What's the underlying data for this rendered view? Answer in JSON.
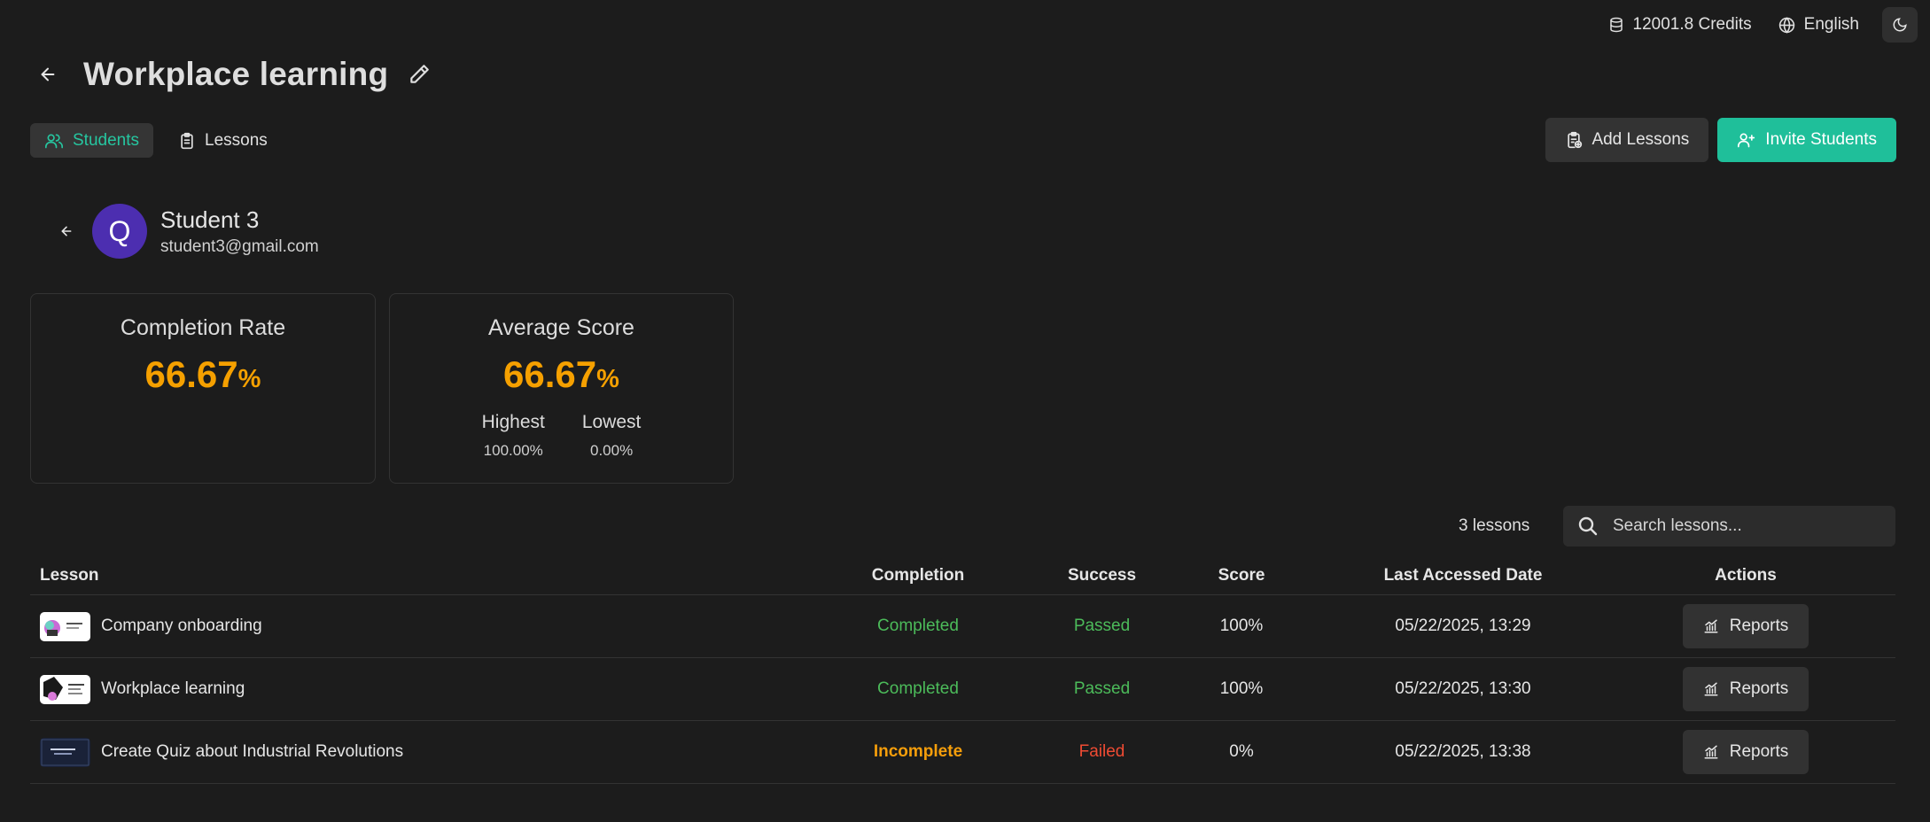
{
  "topbar": {
    "credits": "12001.8 Credits",
    "language": "English",
    "credits_icon": "database-icon",
    "language_icon": "globe-icon",
    "theme_icon": "moon-icon"
  },
  "header": {
    "title": "Workplace learning"
  },
  "tabs": [
    {
      "label": "Students",
      "active": true
    },
    {
      "label": "Lessons",
      "active": false
    }
  ],
  "actions": {
    "add_lessons": "Add Lessons",
    "invite_students": "Invite Students"
  },
  "student": {
    "initial": "Q",
    "name": "Student 3",
    "email": "student3@gmail.com"
  },
  "stats": {
    "completion": {
      "title": "Completion Rate",
      "value": "66.67",
      "unit": "%"
    },
    "average": {
      "title": "Average Score",
      "value": "66.67",
      "unit": "%",
      "highest_label": "Highest",
      "highest_value": "100.00%",
      "lowest_label": "Lowest",
      "lowest_value": "0.00%"
    }
  },
  "table": {
    "count": "3 lessons",
    "search_placeholder": "Search lessons...",
    "headers": {
      "lesson": "Lesson",
      "completion": "Completion",
      "success": "Success",
      "score": "Score",
      "date": "Last Accessed Date",
      "actions": "Actions"
    },
    "rows": [
      {
        "lesson": "Company onboarding",
        "completion": "Completed",
        "success": "Passed",
        "score": "100%",
        "date": "05/22/2025, 13:29",
        "action": "Reports"
      },
      {
        "lesson": "Workplace learning",
        "completion": "Completed",
        "success": "Passed",
        "score": "100%",
        "date": "05/22/2025, 13:30",
        "action": "Reports"
      },
      {
        "lesson": "Create Quiz about Industrial Revolutions",
        "completion": "Incomplete",
        "success": "Failed",
        "score": "0%",
        "date": "05/22/2025, 13:38",
        "action": "Reports"
      }
    ]
  },
  "colors": {
    "accent": "#1fbf9a",
    "warning": "#f5a000",
    "success": "#4cbb5a",
    "danger": "#ef4b33",
    "avatar": "#4c2eb0"
  }
}
